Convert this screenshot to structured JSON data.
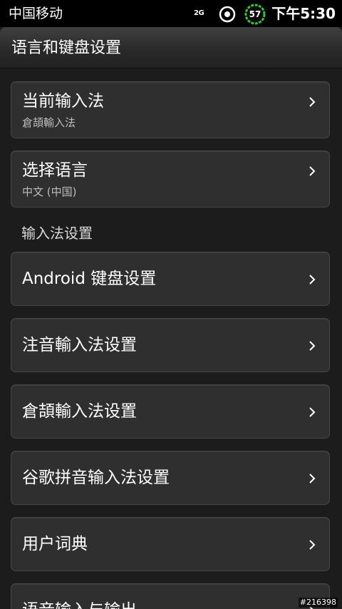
{
  "status_bar": {
    "carrier": "中国移动",
    "network": "2G",
    "battery_level": "57",
    "time": "下午5:30",
    "icons": [
      "sync-icon",
      "battery-icon"
    ]
  },
  "header": {
    "title": "语言和键盘设置"
  },
  "settings": {
    "current_ime": {
      "label": "当前输入法",
      "value": "倉頡輸入法"
    },
    "language": {
      "label": "选择语言",
      "value": "中文 (中国)"
    },
    "ime_section_header": "输入法设置",
    "ime_items": [
      {
        "label": "Android 键盘设置"
      },
      {
        "label": "注音輸入法设置"
      },
      {
        "label": "倉頡輸入法设置"
      },
      {
        "label": "谷歌拼音输入法设置"
      },
      {
        "label": "用户词典"
      },
      {
        "label": "语音输入与输出"
      }
    ]
  },
  "colors": {
    "background": "#1c1c1c",
    "card": "#2f2f2f",
    "battery_accent": "#39c23a"
  },
  "watermark": "#216398"
}
